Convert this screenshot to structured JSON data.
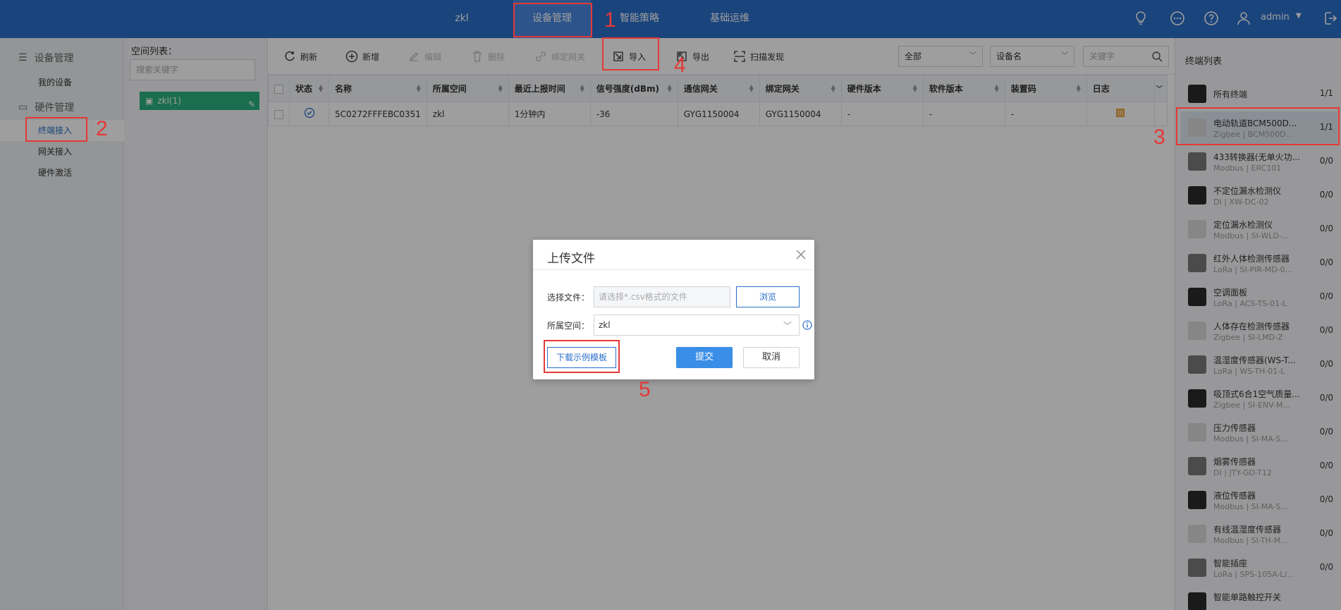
{
  "topbar": {
    "space_name": "zkl",
    "tabs": [
      "设备管理",
      "智能策略",
      "基础运维"
    ],
    "username": "admin"
  },
  "sidebar": {
    "group1": "设备管理",
    "my_devices": "我的设备",
    "group2": "硬件管理",
    "items": [
      "终端接入",
      "网关接入",
      "硬件激活"
    ]
  },
  "space_panel": {
    "title": "空间列表：",
    "search_placeholder": "搜索关键字",
    "node": "zkl(1)"
  },
  "toolbar": {
    "refresh": "刷新",
    "add": "新增",
    "edit": "编辑",
    "delete": "删除",
    "bind_gateway": "绑定网关",
    "import": "导入",
    "export": "导出",
    "scan": "扫描发现",
    "filter_all": "全部",
    "filter_field": "设备名",
    "keyword_placeholder": "关键字"
  },
  "table": {
    "headers": [
      "状态",
      "名称",
      "所属空间",
      "最近上报时间",
      "信号强度(dBm)",
      "通信网关",
      "绑定网关",
      "硬件版本",
      "软件版本",
      "装置码",
      "日志"
    ],
    "rows": [
      [
        "",
        "5C0272FFFEBC0351",
        "zkl",
        "1分钟内",
        "-36",
        "GYG1150004",
        "GYG1150004",
        "-",
        "-",
        "-",
        ""
      ]
    ]
  },
  "right_panel": {
    "title": "终端列表",
    "items": [
      {
        "name": "所有终端",
        "sub": "",
        "count": "1/1"
      },
      {
        "name": "电动轨道BCM500D...",
        "sub": "Zigbee | BCM500D...",
        "count": "1/1"
      },
      {
        "name": "433转换器(无单火功...",
        "sub": "Modbus | ERC101",
        "count": "0/0"
      },
      {
        "name": "不定位漏水检测仪",
        "sub": "DI | XW-DC-02",
        "count": "0/0"
      },
      {
        "name": "定位漏水检测仪",
        "sub": "Modbus | SI-WLD-...",
        "count": "0/0"
      },
      {
        "name": "红外人体检测传感器",
        "sub": "LoRa | SI-PIR-MD-0...",
        "count": "0/0"
      },
      {
        "name": "空调面板",
        "sub": "LoRa | ACS-TS-01-L",
        "count": "0/0"
      },
      {
        "name": "人体存在检测传感器",
        "sub": "Zigbee | SI-LMD-Z",
        "count": "0/0"
      },
      {
        "name": "温湿度传感器(WS-T...",
        "sub": "LoRa | WS-TH-01-L",
        "count": "0/0"
      },
      {
        "name": "吸顶式6合1空气质量...",
        "sub": "Zigbee | SI-ENV-M...",
        "count": "0/0"
      },
      {
        "name": "压力传感器",
        "sub": "Modbus | SI-MA-S...",
        "count": "0/0"
      },
      {
        "name": "烟雾传感器",
        "sub": "DI | JTY-GD-T12",
        "count": "0/0"
      },
      {
        "name": "液位传感器",
        "sub": "Modbus | SI-MA-S...",
        "count": "0/0"
      },
      {
        "name": "有线温湿度传感器",
        "sub": "Modbus | SI-TH-M...",
        "count": "0/0"
      },
      {
        "name": "智能插座",
        "sub": "LoRa | SPS-105A-L/...",
        "count": "0/0"
      },
      {
        "name": "智能单路触控开关",
        "sub": "",
        "count": ""
      }
    ]
  },
  "modal": {
    "title": "上传文件",
    "file_label": "选择文件：",
    "file_placeholder": "请选择*.csv格式的文件",
    "browse": "浏览",
    "space_label": "所属空间：",
    "space_value": "zkl",
    "download_template": "下载示例模板",
    "submit": "提交",
    "cancel": "取消"
  },
  "annotations": [
    "1",
    "2",
    "3",
    "4",
    "5"
  ],
  "colors": {
    "primary": "#2a6ec9",
    "space_node": "#2ab07f",
    "annotation": "#e53935"
  }
}
